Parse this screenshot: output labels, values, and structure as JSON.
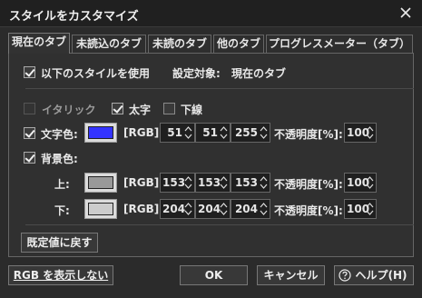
{
  "window": {
    "title": "スタイルをカスタマイズ"
  },
  "tabs": [
    {
      "label": "現在のタブ",
      "active": true
    },
    {
      "label": "未読込のタブ",
      "active": false
    },
    {
      "label": "未読のタブ",
      "active": false
    },
    {
      "label": "他のタブ",
      "active": false
    },
    {
      "label": "プログレスメーター（タブ）",
      "active": false
    }
  ],
  "panel": {
    "use_style": {
      "label": "以下のスタイルを使用",
      "checked": true
    },
    "target": {
      "label": "設定対象:",
      "value": "現在のタブ"
    },
    "italic": {
      "label": "イタリック",
      "checked": false,
      "enabled": false
    },
    "bold": {
      "label": "太字",
      "checked": true
    },
    "underline": {
      "label": "下線",
      "checked": false
    },
    "text_color": {
      "label": "文字色:",
      "checked": true,
      "swatch": "#3333ff",
      "rgb_label": "[RGB]:",
      "r": "51",
      "g": "51",
      "b": "255",
      "opacity_label": "不透明度[%]:",
      "opacity": "100"
    },
    "bg_color": {
      "label": "背景色:",
      "checked": true
    },
    "bg_top": {
      "label": "上:",
      "swatch": "#999999",
      "rgb_label": "[RGB]:",
      "r": "153",
      "g": "153",
      "b": "153",
      "opacity_label": "不透明度[%]:",
      "opacity": "100"
    },
    "bg_bottom": {
      "label": "下:",
      "swatch": "#cccccc",
      "rgb_label": "[RGB]:",
      "r": "204",
      "g": "204",
      "b": "204",
      "opacity_label": "不透明度[%]:",
      "opacity": "100"
    },
    "reset_label": "既定値に戻す"
  },
  "footer": {
    "hide_rgb_label": "RGB を表示しない",
    "ok_label": "OK",
    "cancel_label": "キャンセル",
    "help_label": "ヘルプ(H)",
    "help_icon": "question-circle-icon"
  }
}
